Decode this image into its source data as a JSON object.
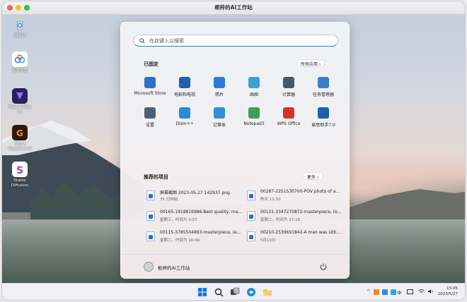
{
  "window": {
    "title": "栀梓的AI工作站"
  },
  "desktop_icons": [
    {
      "label": "回收站",
      "icon": "recycle-bin-icon"
    },
    {
      "label": "百度网盘",
      "icon": "baidu-netdisk-icon"
    },
    {
      "label": "Topaz Video AI",
      "icon": "topaz-video-ai-icon"
    },
    {
      "label": "Topaz Gigapixel AI",
      "icon": "topaz-gigapixel-icon"
    },
    {
      "label": "Stable Diffusion",
      "icon": "stable-diffusion-icon"
    }
  ],
  "start_menu": {
    "search_placeholder": "在此键入以搜索",
    "pinned_title": "已固定",
    "all_apps_label": "所有应用",
    "pinned": [
      {
        "label": "Microsoft Store",
        "icon": "store-icon",
        "color": "#2f6fc4"
      },
      {
        "label": "电影和电视",
        "icon": "movies-icon",
        "color": "#1e5fb8"
      },
      {
        "label": "照片",
        "icon": "photos-icon",
        "color": "#2a7bd6"
      },
      {
        "label": "画图",
        "icon": "paint-icon",
        "color": "#3aa3d8"
      },
      {
        "label": "计算器",
        "icon": "calculator-icon",
        "color": "#4a5866"
      },
      {
        "label": "任务管理器",
        "icon": "task-manager-icon",
        "color": "#3d7cc9"
      },
      {
        "label": "设置",
        "icon": "settings-icon",
        "color": "#4d5f73"
      },
      {
        "label": "Dism++",
        "icon": "dism-icon",
        "color": "#2a8ad6"
      },
      {
        "label": "记事本",
        "icon": "notepad-icon",
        "color": "#2f8fd8"
      },
      {
        "label": "Notepad3",
        "icon": "notepad3-icon",
        "color": "#3b9e5c"
      },
      {
        "label": "WPS Office",
        "icon": "wps-icon",
        "color": "#d8322f"
      },
      {
        "label": "易思助手7.0",
        "icon": "assistant-icon",
        "color": "#1f5fb0"
      }
    ],
    "recommended_title": "推荐的项目",
    "more_label": "更多",
    "recommended": [
      {
        "name": "屏幕截图 2023-05-27 142937.png",
        "time": "35 分钟前"
      },
      {
        "name": "00287-2251530700-POV photo of a...",
        "time": "昨天 11:50"
      },
      {
        "name": "00165-1918816986-Best quality, ma...",
        "time": "星期三，时间为 9:57"
      },
      {
        "name": "00131-3347270872-masterpiece, (e...",
        "time": "星期二，时间为 17:16"
      },
      {
        "name": "00115-3785504893-masterpiece, (e...",
        "time": "星期二，时间为 16:48"
      },
      {
        "name": "00210-2539691842-A man was sitti...",
        "time": "5月13日"
      }
    ],
    "user_name": "栀梓的AI工作站"
  },
  "taskbar": {
    "apps": [
      {
        "name": "start",
        "icon": "windows-start-icon"
      },
      {
        "name": "search",
        "icon": "search-icon"
      },
      {
        "name": "task-view",
        "icon": "task-view-icon"
      },
      {
        "name": "edge",
        "icon": "edge-icon"
      },
      {
        "name": "file-explorer",
        "icon": "folder-icon"
      }
    ],
    "ime_label": "中",
    "time": "15:05",
    "date": "2023/5/27"
  }
}
